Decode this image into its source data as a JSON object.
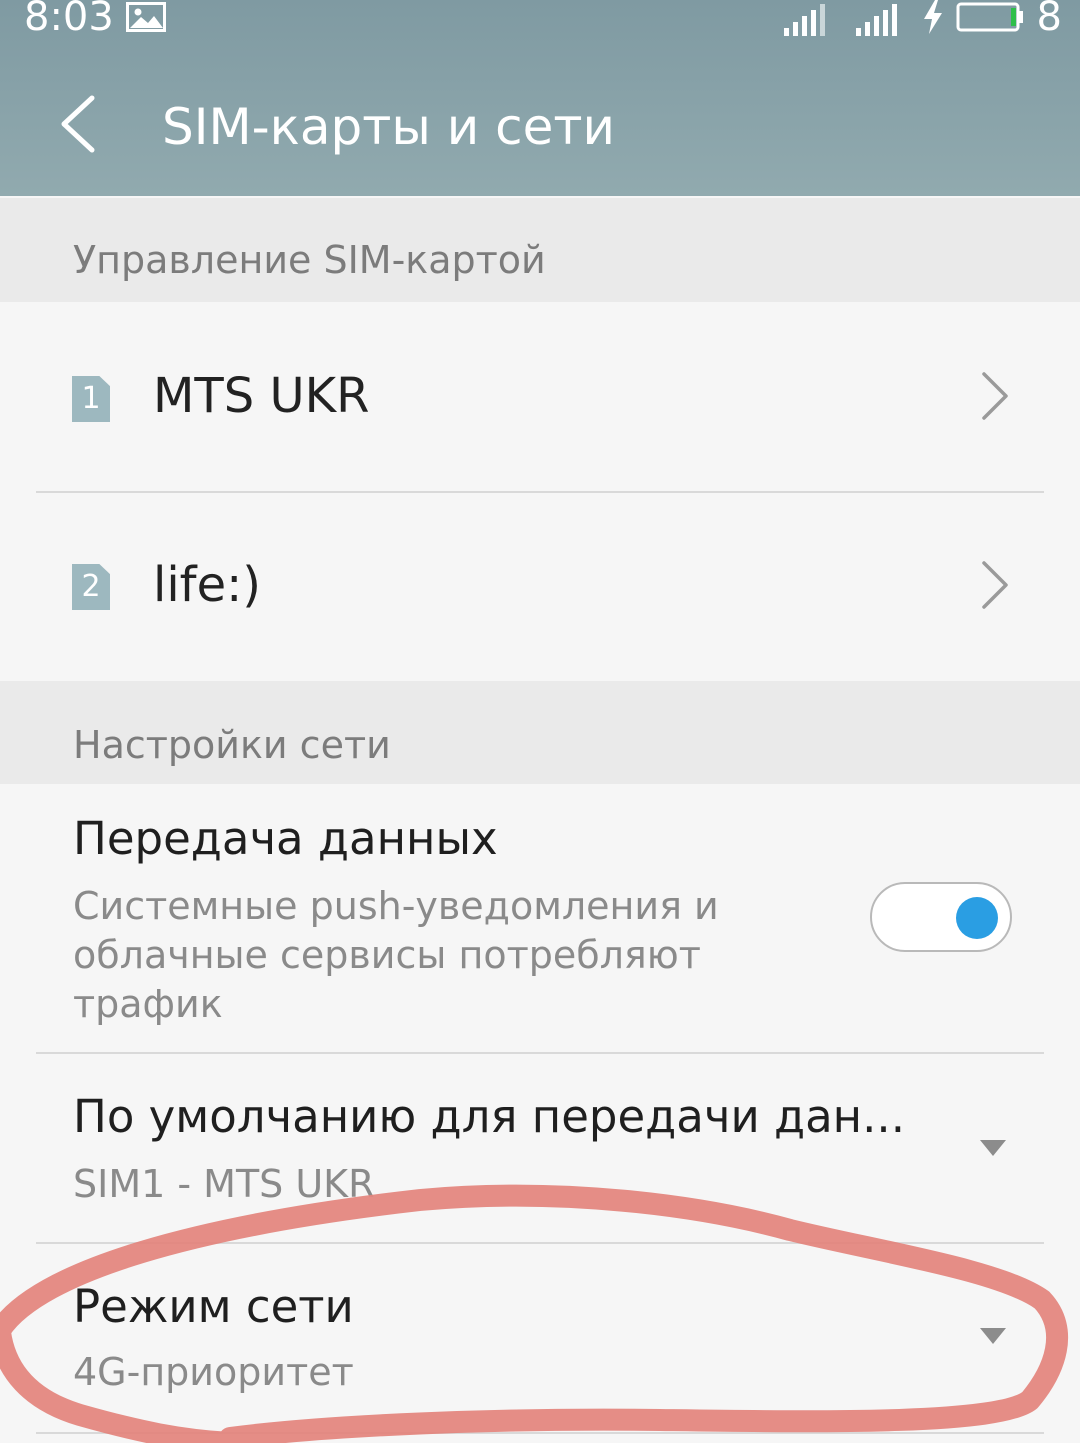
{
  "status_bar": {
    "time": "8:03",
    "battery_level": "8",
    "icons": [
      "image-notification-icon",
      "signal-sim1-icon",
      "signal-sim2-icon",
      "charging-bolt-icon",
      "battery-icon"
    ]
  },
  "app_bar": {
    "title": "SIM-карты и сети",
    "back_icon": "chevron-left-icon"
  },
  "sim_section": {
    "header": "Управление SIM-картой",
    "sims": [
      {
        "slot": "1",
        "name": "MTS UKR"
      },
      {
        "slot": "2",
        "name": "life:)"
      }
    ]
  },
  "network_section": {
    "header": "Настройки сети",
    "data_transfer": {
      "title": "Передача данных",
      "description": "Системные push-уведомления и облачные сервисы потребляют трафик",
      "enabled": true
    },
    "default_data": {
      "title": "По умолчанию для передачи дан...",
      "value": "SIM1 - MTS UKR"
    },
    "network_mode": {
      "title": "Режим сети",
      "value": "4G-приоритет"
    }
  },
  "colors": {
    "app_bar": "#869fa6",
    "toggle_on": "#2a9ee3",
    "sim_badge": "#9db8bf",
    "annotation_stroke": "#e3837c"
  }
}
